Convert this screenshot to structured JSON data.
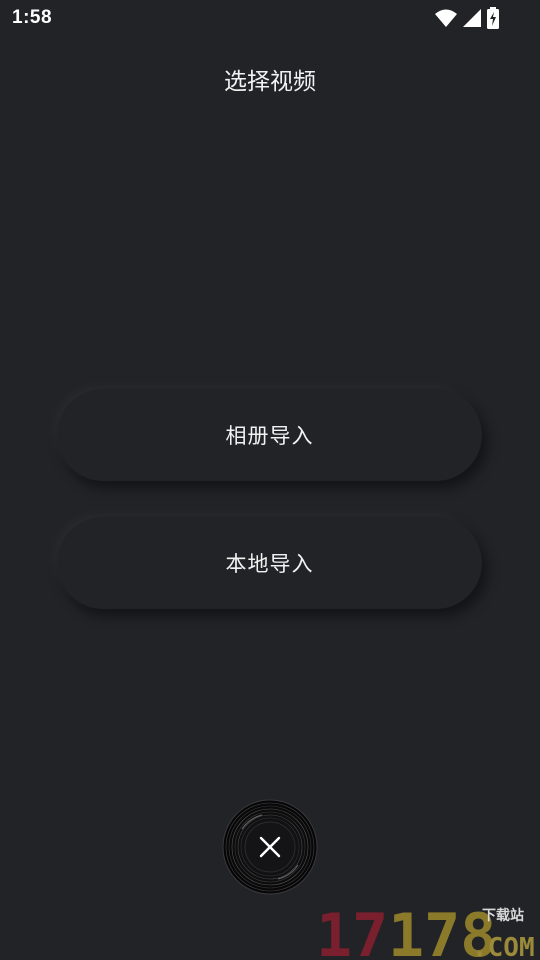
{
  "status_bar": {
    "time": "1:58",
    "icons": [
      "wifi-icon",
      "cellular-signal-icon",
      "battery-charging-icon"
    ]
  },
  "page": {
    "title": "选择视频"
  },
  "buttons": {
    "album_import": "相册导入",
    "local_import": "本地导入"
  },
  "close_button": {
    "icon": "close-icon"
  },
  "watermark": {
    "number": "17178",
    "domain": ".COM",
    "tagline": "下载站",
    "colors": {
      "one_seven": "#7a1f2e",
      "one_seven_eight": "#8a7a2a",
      "com": "#9a8a3a",
      "tagline": "#d9d9d9"
    }
  },
  "colors": {
    "background": "#222327",
    "text": "#f2f2f2"
  }
}
